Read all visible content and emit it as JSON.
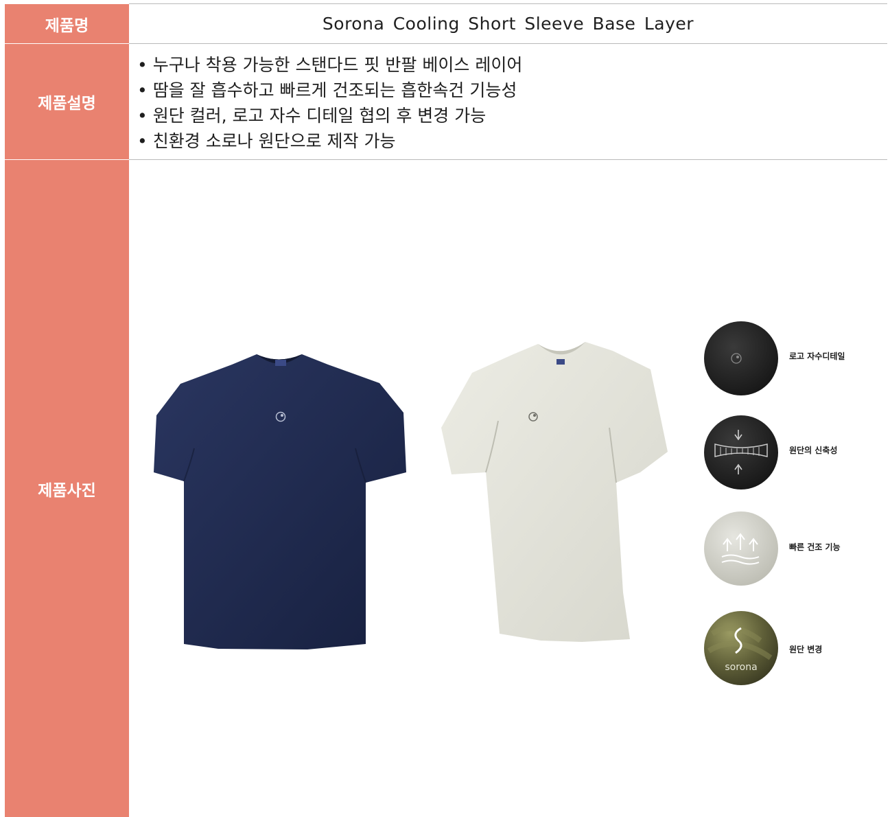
{
  "rows": {
    "name": {
      "label": "제품명",
      "value": "Sorona  Cooling  Short  Sleeve  Base  Layer"
    },
    "description": {
      "label": "제품설명",
      "bullets": [
        "• 누구나 착용 가능한 스탠다드 핏 반팔 베이스 레이어",
        "• 땀을 잘 흡수하고 빠르게 건조되는 흡한속건 기능성",
        "• 원단 컬러, 로고 자수 디테일 협의 후 변경 가능",
        "• 친환경 소로나 원단으로 제작 가능"
      ]
    },
    "photo": {
      "label": "제품사진",
      "features": [
        "로고 자수디테일",
        "원단의 신축성",
        "빠른 건조 기능",
        "원단 변경"
      ],
      "fabric_logo_text": "sorona"
    }
  },
  "colors": {
    "header_bg": "#e98270",
    "navy_shirt": "#1f2a4e",
    "light_shirt": "#e4e4db",
    "dark_circle": "#262626",
    "light_circle": "#d9d9d2",
    "olive_circle": "#6b6a3f"
  }
}
